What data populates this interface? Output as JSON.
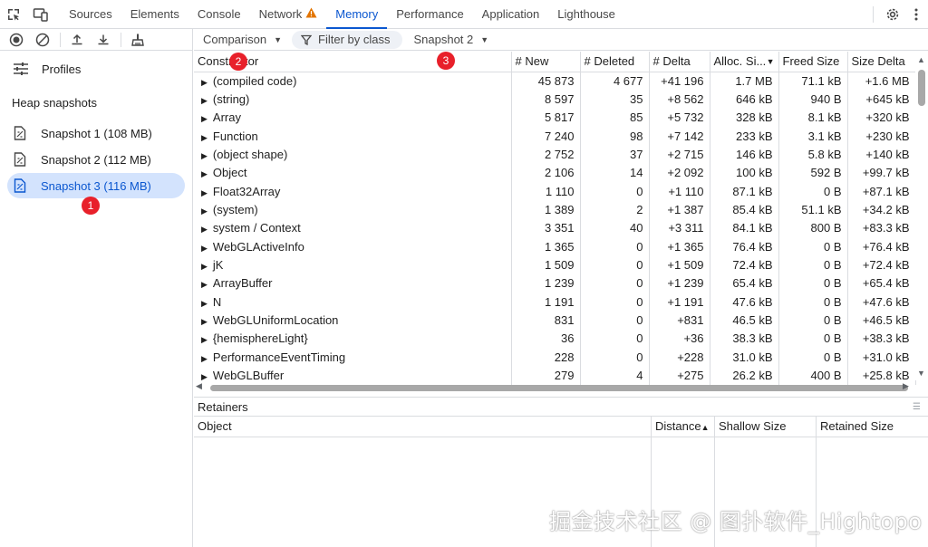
{
  "topbar": {
    "tabs": [
      {
        "label": "Sources"
      },
      {
        "label": "Elements"
      },
      {
        "label": "Console"
      },
      {
        "label": "Network"
      },
      {
        "label": "Memory"
      },
      {
        "label": "Performance"
      },
      {
        "label": "Application"
      },
      {
        "label": "Lighthouse"
      }
    ],
    "active_tab": "Memory"
  },
  "sidebar": {
    "profiles_label": "Profiles",
    "section_title": "Heap snapshots",
    "snapshots": [
      {
        "label": "Snapshot 1 (108 MB)"
      },
      {
        "label": "Snapshot 2 (112 MB)"
      },
      {
        "label": "Snapshot 3 (116 MB)"
      }
    ],
    "selected_index": 2
  },
  "toolbar": {
    "view_mode": "Comparison",
    "filter_placeholder": "Filter by class",
    "base_snapshot": "Snapshot 2"
  },
  "table": {
    "columns": [
      "Constructor",
      "# New",
      "# Deleted",
      "# Delta",
      "Alloc. Si...",
      "Freed Size",
      "Size Delta"
    ],
    "rows": [
      [
        "(compiled code)",
        "45 873",
        "4 677",
        "+41 196",
        "1.7 MB",
        "71.1 kB",
        "+1.6 MB"
      ],
      [
        "(string)",
        "8 597",
        "35",
        "+8 562",
        "646 kB",
        "940 B",
        "+645 kB"
      ],
      [
        "Array",
        "5 817",
        "85",
        "+5 732",
        "328 kB",
        "8.1 kB",
        "+320 kB"
      ],
      [
        "Function",
        "7 240",
        "98",
        "+7 142",
        "233 kB",
        "3.1 kB",
        "+230 kB"
      ],
      [
        "(object shape)",
        "2 752",
        "37",
        "+2 715",
        "146 kB",
        "5.8 kB",
        "+140 kB"
      ],
      [
        "Object",
        "2 106",
        "14",
        "+2 092",
        "100 kB",
        "592 B",
        "+99.7 kB"
      ],
      [
        "Float32Array",
        "1 110",
        "0",
        "+1 110",
        "87.1 kB",
        "0 B",
        "+87.1 kB"
      ],
      [
        "(system)",
        "1 389",
        "2",
        "+1 387",
        "85.4 kB",
        "51.1 kB",
        "+34.2 kB"
      ],
      [
        "system / Context",
        "3 351",
        "40",
        "+3 311",
        "84.1 kB",
        "800 B",
        "+83.3 kB"
      ],
      [
        "WebGLActiveInfo",
        "1 365",
        "0",
        "+1 365",
        "76.4 kB",
        "0 B",
        "+76.4 kB"
      ],
      [
        "jK",
        "1 509",
        "0",
        "+1 509",
        "72.4 kB",
        "0 B",
        "+72.4 kB"
      ],
      [
        "ArrayBuffer",
        "1 239",
        "0",
        "+1 239",
        "65.4 kB",
        "0 B",
        "+65.4 kB"
      ],
      [
        "N",
        "1 191",
        "0",
        "+1 191",
        "47.6 kB",
        "0 B",
        "+47.6 kB"
      ],
      [
        "WebGLUniformLocation",
        "831",
        "0",
        "+831",
        "46.5 kB",
        "0 B",
        "+46.5 kB"
      ],
      [
        "{hemisphereLight}",
        "36",
        "0",
        "+36",
        "38.3 kB",
        "0 B",
        "+38.3 kB"
      ],
      [
        "PerformanceEventTiming",
        "228",
        "0",
        "+228",
        "31.0 kB",
        "0 B",
        "+31.0 kB"
      ],
      [
        "WebGLBuffer",
        "279",
        "4",
        "+275",
        "26.2 kB",
        "400 B",
        "+25.8 kB"
      ]
    ]
  },
  "retainers": {
    "title": "Retainers",
    "columns": [
      "Object",
      "Distance",
      "Shallow Size",
      "Retained Size"
    ]
  },
  "badges": [
    "1",
    "2",
    "3"
  ],
  "watermark": "掘金技术社区 @ 图扑软件_Hightopo",
  "colors": {
    "accent": "#0b57d0",
    "selected_bg": "#d3e3fd",
    "badge": "#e8202a",
    "warning": "#e37400"
  }
}
